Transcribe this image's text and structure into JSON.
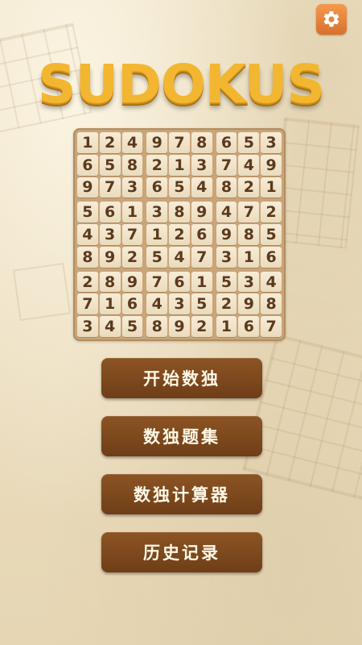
{
  "app": {
    "title": "SUDOKUS"
  },
  "settings": {
    "icon": "gear-icon",
    "color": "#e8843c"
  },
  "board": {
    "grid": [
      [
        1,
        2,
        4,
        9,
        7,
        8,
        6,
        5,
        3
      ],
      [
        6,
        5,
        8,
        2,
        1,
        3,
        7,
        4,
        9
      ],
      [
        9,
        7,
        3,
        6,
        5,
        4,
        8,
        2,
        1
      ],
      [
        5,
        6,
        1,
        3,
        8,
        9,
        4,
        7,
        2
      ],
      [
        4,
        3,
        7,
        1,
        2,
        6,
        9,
        8,
        5
      ],
      [
        8,
        9,
        2,
        5,
        4,
        7,
        3,
        1,
        6
      ],
      [
        2,
        8,
        9,
        7,
        6,
        1,
        5,
        3,
        4
      ],
      [
        7,
        1,
        6,
        4,
        3,
        5,
        2,
        9,
        8
      ],
      [
        3,
        4,
        5,
        8,
        9,
        2,
        1,
        6,
        7
      ]
    ]
  },
  "menu": {
    "items": [
      {
        "label": "开始数独"
      },
      {
        "label": "数独题集"
      },
      {
        "label": "数独计算器"
      },
      {
        "label": "历史记录"
      }
    ]
  },
  "colors": {
    "title": "#f3b631",
    "button": "#7d4a1f",
    "button_text": "#fff7e6",
    "cell_text": "#5b3a1e"
  }
}
